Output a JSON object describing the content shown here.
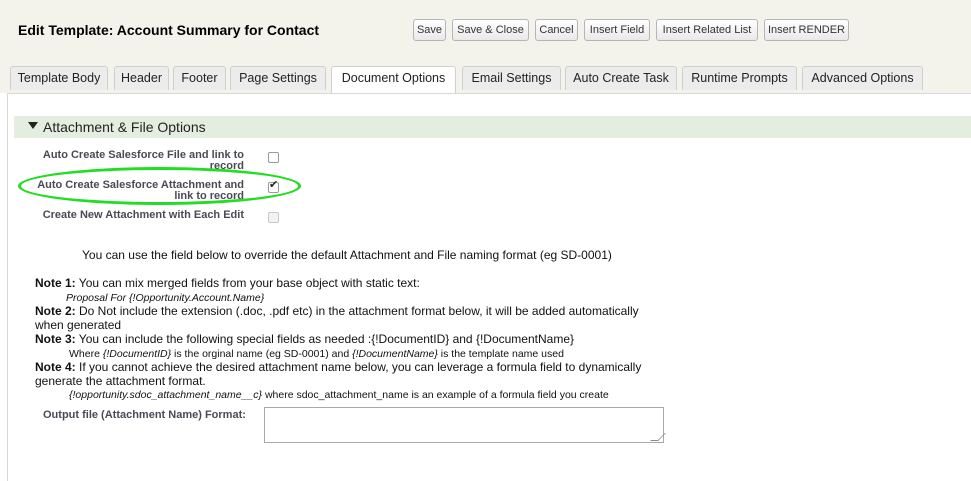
{
  "header": {
    "title": "Edit Template: Account Summary for Contact",
    "buttons": {
      "save": "Save",
      "save_close": "Save & Close",
      "cancel": "Cancel",
      "insert_field": "Insert Field",
      "insert_related_list": "Insert Related List",
      "insert_render": "Insert RENDER"
    }
  },
  "tabs": {
    "template_body": "Template Body",
    "header": "Header",
    "footer": "Footer",
    "page_settings": "Page Settings",
    "document_options": "Document Options",
    "email_settings": "Email Settings",
    "auto_create_task": "Auto Create Task",
    "runtime_prompts": "Runtime Prompts",
    "advanced_options": "Advanced Options",
    "active": "Document Options"
  },
  "section": {
    "title": "Attachment & File Options"
  },
  "options": {
    "auto_file_l1": "Auto Create Salesforce File and link to",
    "auto_file_l2": "record",
    "auto_file_checked": false,
    "auto_attach_l1": "Auto Create Salesforce Attachment and",
    "auto_attach_l2": "link to record",
    "auto_attach_checked": true,
    "new_attach": "Create New Attachment with Each Edit",
    "new_attach_checked": false
  },
  "info": "You can use the field below to override the default Attachment and File naming format (eg SD-0001)",
  "notes": {
    "n1_label": "Note 1:",
    "n1_text": " You can mix merged fields from your base object with static text:",
    "n1_example": "Proposal For {!Opportunity.Account.Name}",
    "n2_label": "Note 2:",
    "n2_text": " Do Not include the extension (.doc, .pdf etc) in the attachment format below, it will be added automatically",
    "n2_text2": "when generated",
    "n3_label": "Note 3:",
    "n3_text": " You can include the following special fields as needed :{!DocumentID} and {!DocumentName}",
    "n3_ex_a": "Where ",
    "n3_ex_b": "{!DocumentID}",
    "n3_ex_c": " is the orginal name (eg SD-0001) and ",
    "n3_ex_d": "{!DocumentName}",
    "n3_ex_e": " is the template name used",
    "n4_label": "Note 4:",
    "n4_text": " If you cannot achieve the desired attachment name below, you can leverage a formula field to dynamically",
    "n4_text2": "generate the attachment format.",
    "n4_ex_a": "{!opportunity.sdoc_attachment_name__c}",
    "n4_ex_b": " where sdoc_attachment_name is an example of a formula field you create"
  },
  "output": {
    "label": "Output file (Attachment Name) Format:",
    "value": ""
  },
  "colors": {
    "highlight_oval": "#22dd22",
    "section_bg": "#e3eee1"
  }
}
